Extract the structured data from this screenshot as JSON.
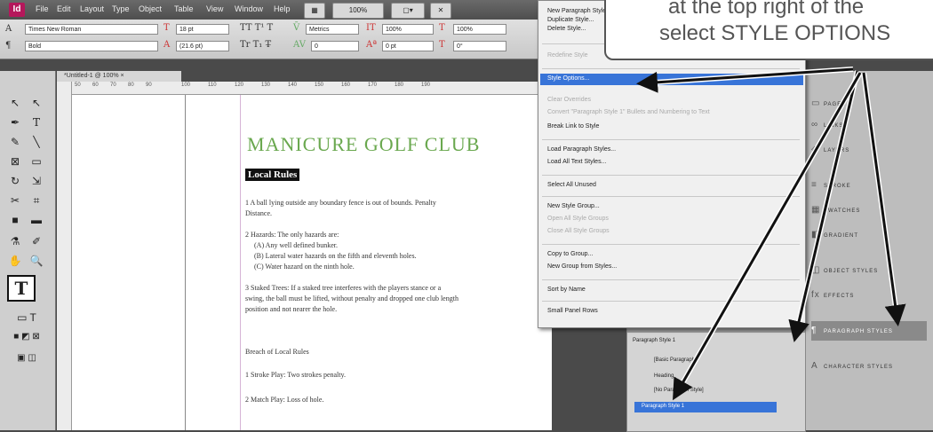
{
  "menubar": {
    "logo": "Id",
    "items": [
      "File",
      "Edit",
      "Layout",
      "Type",
      "Object",
      "Table",
      "View",
      "Window",
      "Help"
    ],
    "zoom": "100%"
  },
  "control": {
    "font_family": "Times New Roman",
    "font_style": "Bold",
    "font_size": "18 pt",
    "leading": "(21.6 pt)",
    "kerning": "Metrics",
    "tracking": "0",
    "vscale": "100%",
    "baseline": "0 pt",
    "hscale": "100%",
    "angle": "0°"
  },
  "document": {
    "tab_label": "*Untitled-1 @ 100% ×",
    "ruler_ticks": [
      "50",
      "60",
      "70",
      "80",
      "90",
      "100",
      "110",
      "120",
      "130",
      "140",
      "150",
      "160",
      "170",
      "180",
      "190"
    ],
    "title": "MANICURE GOLF CLUB",
    "heading": "Local Rules",
    "lines": [
      "1      A ball lying outside any boundary fence is out of bounds.  Penalty",
      "Distance.",
      "2      Hazards:  The only hazards are:",
      "(A)     Any well defined bunker.",
      "(B)     Lateral water hazards on the fifth and eleventh holes.",
      "(C)     Water hazard on the ninth hole.",
      "3      Staked Trees:  If a staked tree interferes with the players stance or a",
      "swing, the ball must be lifted, without penalty and dropped one club length",
      "position and not nearer the hole.",
      "Breach of Local Rules",
      "1      Stroke Play:  Two strokes penalty.",
      "2      Match Play:  Loss of hole."
    ]
  },
  "flyout": {
    "items": [
      {
        "label": "New Paragraph Style...",
        "disabled": false
      },
      {
        "label": "Duplicate Style...",
        "disabled": false
      },
      {
        "label": "Delete Style...",
        "disabled": false
      },
      {
        "label": "Redefine Style",
        "disabled": true
      },
      {
        "label": "Style Options...",
        "disabled": false,
        "highlight": true
      },
      {
        "label": "Clear Overrides",
        "disabled": true
      },
      {
        "label": "Convert \"Paragraph Style 1\" Bullets and Numbering to Text",
        "disabled": true
      },
      {
        "label": "Break Link to Style",
        "disabled": false
      },
      {
        "label": "Load Paragraph Styles...",
        "disabled": false
      },
      {
        "label": "Load All Text Styles...",
        "disabled": false
      },
      {
        "label": "Select All Unused",
        "disabled": false
      },
      {
        "label": "New Style Group...",
        "disabled": false
      },
      {
        "label": "Open All Style Groups",
        "disabled": true
      },
      {
        "label": "Close All Style Groups",
        "disabled": true
      },
      {
        "label": "Copy to Group...",
        "disabled": false
      },
      {
        "label": "New Group from Styles...",
        "disabled": false
      },
      {
        "label": "Sort by Name",
        "disabled": false
      },
      {
        "label": "Small Panel Rows",
        "disabled": false
      }
    ]
  },
  "rightpanels": {
    "items": [
      "PAGES",
      "LINKS",
      "LAYERS",
      "STROKE",
      "SWATCHES",
      "GRADIENT",
      "OBJECT STYLES",
      "EFFECTS",
      "PARAGRAPH STYLES",
      "CHARACTER STYLES"
    ]
  },
  "pstyles": {
    "tab": "PARAGRAPH STYLES",
    "current": "Paragraph Style 1",
    "rows": [
      "[Basic Paragraph]",
      "Heading",
      "[No Paragraph Style]"
    ],
    "selected": "Paragraph Style 1"
  },
  "callout": {
    "line1": "at the top right of the",
    "line2": "select STYLE OPTIONS"
  }
}
